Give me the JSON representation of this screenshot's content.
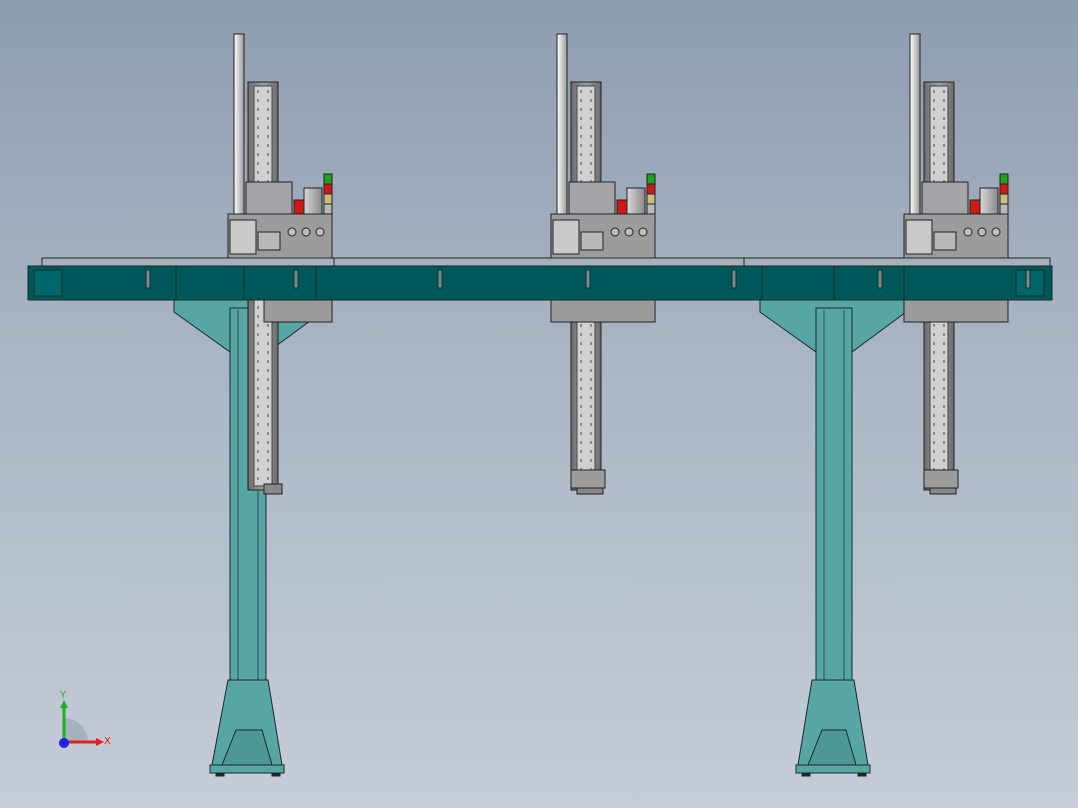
{
  "scene": {
    "background_top": "#8e9db0",
    "background_bottom": "#c6ccd8",
    "frame_color": "#58a6a3",
    "beam_color": "#00585a",
    "carriage_color": "#9c9c9c",
    "column_color": "#7a7a7a",
    "stack_light_colors": [
      "#1ea31e",
      "#d01818",
      "#c8c078"
    ],
    "valve_color": "#d01818",
    "gantry_units": 3
  },
  "triad": {
    "x_label": "X",
    "y_label": "Y",
    "x_color": "#e02020",
    "y_color": "#20b020",
    "z_color": "#2020e0"
  }
}
